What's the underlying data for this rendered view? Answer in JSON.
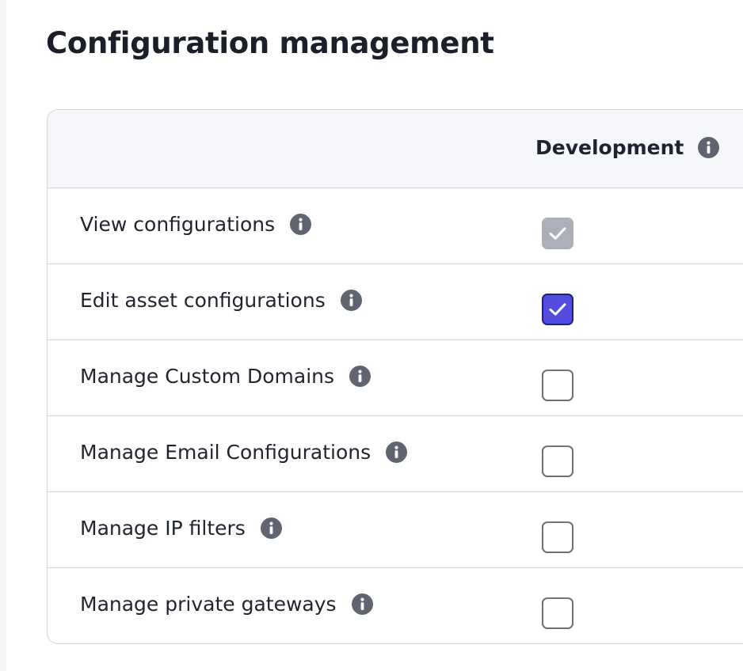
{
  "page": {
    "title": "Configuration management"
  },
  "table": {
    "columns": [
      {
        "label": "Development",
        "icon": "info-icon"
      }
    ],
    "rows": [
      {
        "label": "View configurations",
        "icon": "info-icon",
        "state": "checked-disabled"
      },
      {
        "label": "Edit asset configurations",
        "icon": "info-icon",
        "state": "checked"
      },
      {
        "label": "Manage Custom Domains",
        "icon": "info-icon",
        "state": "unchecked"
      },
      {
        "label": "Manage Email Configurations",
        "icon": "info-icon",
        "state": "unchecked"
      },
      {
        "label": "Manage IP filters",
        "icon": "info-icon",
        "state": "unchecked"
      },
      {
        "label": "Manage private gateways",
        "icon": "info-icon",
        "state": "unchecked"
      }
    ]
  },
  "colors": {
    "checked_fill": "#544ce0",
    "checked_border": "#23207a",
    "disabled_fill": "#abb0b9",
    "unchecked_border": "#6b717d",
    "info_icon": "#5f6470",
    "header_background": "#f6f7fa",
    "divider": "#d3d6dc"
  }
}
